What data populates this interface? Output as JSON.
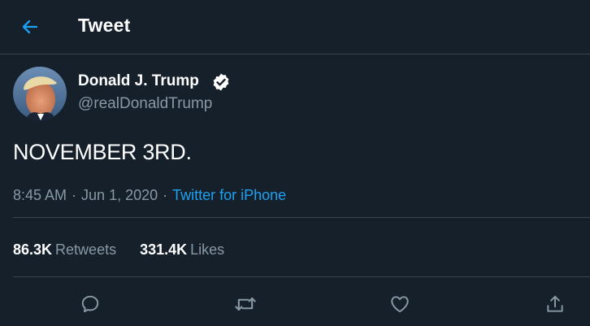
{
  "header": {
    "title": "Tweet",
    "back_icon": "back-arrow-icon"
  },
  "colors": {
    "background": "#15202b",
    "accent": "#1da1f2",
    "muted": "#8899a6",
    "divider": "#38444d"
  },
  "tweet": {
    "display_name": "Donald J. Trump",
    "handle": "@realDonaldTrump",
    "verified": true,
    "text": "NOVEMBER 3RD.",
    "time": "8:45 AM",
    "date": "Jun 1, 2020",
    "separator": "·",
    "source": "Twitter for iPhone"
  },
  "stats": {
    "retweets_count": "86.3K",
    "retweets_label": "Retweets",
    "likes_count": "331.4K",
    "likes_label": "Likes"
  },
  "actions": [
    "reply-icon",
    "retweet-icon",
    "like-icon",
    "share-icon"
  ]
}
